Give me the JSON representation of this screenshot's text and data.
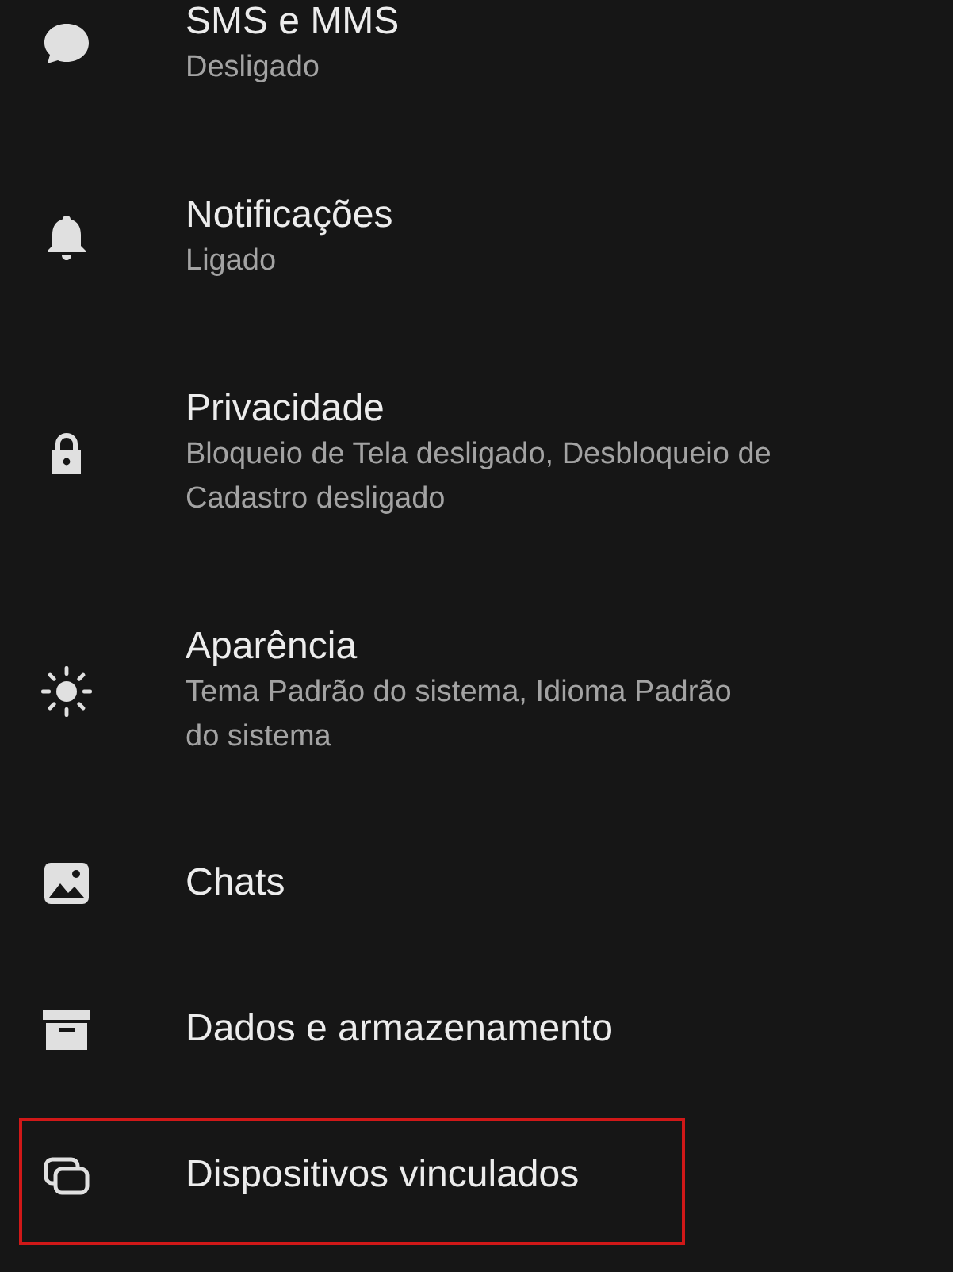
{
  "settings": [
    {
      "title": "SMS e MMS",
      "subtitle": "Desligado",
      "highlighted": false
    },
    {
      "title": "Notificações",
      "subtitle": "Ligado",
      "highlighted": false
    },
    {
      "title": "Privacidade",
      "subtitle": "Bloqueio de Tela desligado, Desbloqueio de\nCadastro desligado",
      "highlighted": false
    },
    {
      "title": "Aparência",
      "subtitle": "Tema Padrão do sistema, Idioma Padrão\ndo sistema",
      "highlighted": false
    },
    {
      "title": "Chats",
      "highlighted": false
    },
    {
      "title": "Dados e armazenamento",
      "highlighted": false
    },
    {
      "title": "Dispositivos vinculados",
      "highlighted": true
    }
  ]
}
